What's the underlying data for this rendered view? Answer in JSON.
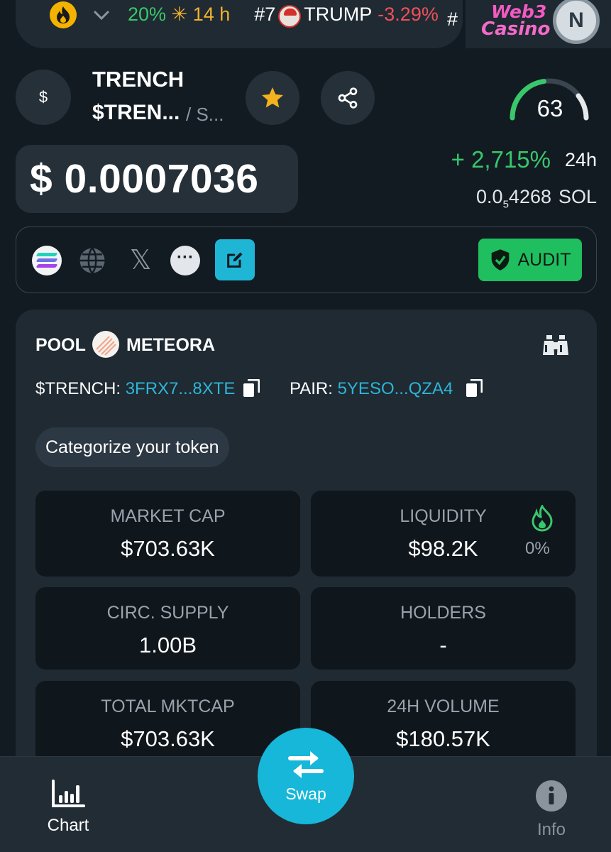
{
  "ticker": {
    "partial_pct": "20%",
    "period": "14 h",
    "rank": "#7",
    "coin": "TRUMP",
    "change": "-3.29%",
    "next_hash": "#"
  },
  "ad": {
    "line1": "Web3",
    "line2": "Casino",
    "logo_letter": "N"
  },
  "token": {
    "avatar_symbol": "$",
    "name": "TRENCH",
    "symbol": "$TREN...",
    "chain_suffix": "/ S..."
  },
  "score": {
    "value": "63",
    "fraction": 0.63
  },
  "price": {
    "usd": "$ 0.0007036",
    "change_pct": "+ 2,715%",
    "change_period": "24h",
    "sol_prefix": "0.0",
    "sol_sub": "5",
    "sol_rest": "4268",
    "sol_unit": "SOL"
  },
  "actions": {
    "audit_label": "AUDIT"
  },
  "pool": {
    "label": "POOL",
    "dex": "METEORA",
    "token_key": "$TRENCH:",
    "token_address": "3FRX7...8XTE",
    "pair_key": "PAIR:",
    "pair_address": "5YESO...QZA4",
    "categorize_label": "Categorize your token"
  },
  "stats": {
    "market_cap_title": "MARKET CAP",
    "market_cap": "$703.63K",
    "liquidity_title": "LIQUIDITY",
    "liquidity": "$98.2K",
    "liquidity_burn": "0%",
    "circ_supply_title": "CIRC. SUPPLY",
    "circ_supply": "1.00B",
    "holders_title": "HOLDERS",
    "holders": "-",
    "total_mktcap_title": "TOTAL MKTCAP",
    "total_mktcap": "$703.63K",
    "volume_title": "24H VOLUME",
    "volume": "$180.57K"
  },
  "nav": {
    "chart_label": "Chart",
    "swap_label": "Swap",
    "info_label": "Info"
  },
  "colors": {
    "background": "#131b22",
    "card": "#1f2a33",
    "positive": "#39c76b",
    "negative": "#f0505a",
    "accent_cyan": "#16b7d8",
    "audit_green": "#1fbf5f"
  }
}
